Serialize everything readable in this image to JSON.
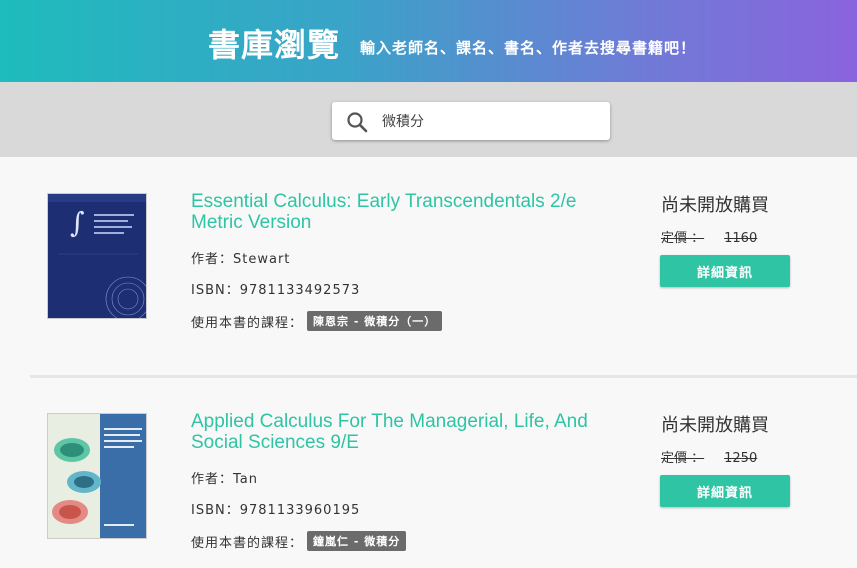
{
  "header": {
    "title": "書庫瀏覽",
    "subtitle": "輸入老師名、課名、書名、作者去搜尋書籍吧！"
  },
  "search": {
    "value": "微積分",
    "icon": "search-icon"
  },
  "books": [
    {
      "title": "Essential Calculus: Early Transcendentals 2/e Metric Version",
      "author": "作者：Stewart",
      "isbn": "ISBN：9781133492573",
      "course_label": "使用本書的課程：",
      "course": "陳恩宗 - 微積分（一）",
      "status": "尚未開放購買",
      "price_label": "定價 ：",
      "price": "1160",
      "button": "詳細資訊"
    },
    {
      "title": "Applied Calculus For The Managerial, Life, And Social Sciences 9/E",
      "author": "作者：Tan",
      "isbn": "ISBN：9781133960195",
      "course_label": "使用本書的課程：",
      "course": "鐘嵐仁 - 微積分",
      "status": "尚未開放購買",
      "price_label": "定價 ：",
      "price": "1250",
      "button": "詳細資訊"
    }
  ],
  "colors": {
    "accent": "#2ec4a4",
    "banner_start": "#1ebcbc",
    "banner_end": "#8b63de",
    "tag_bg": "#6b6b6b"
  }
}
